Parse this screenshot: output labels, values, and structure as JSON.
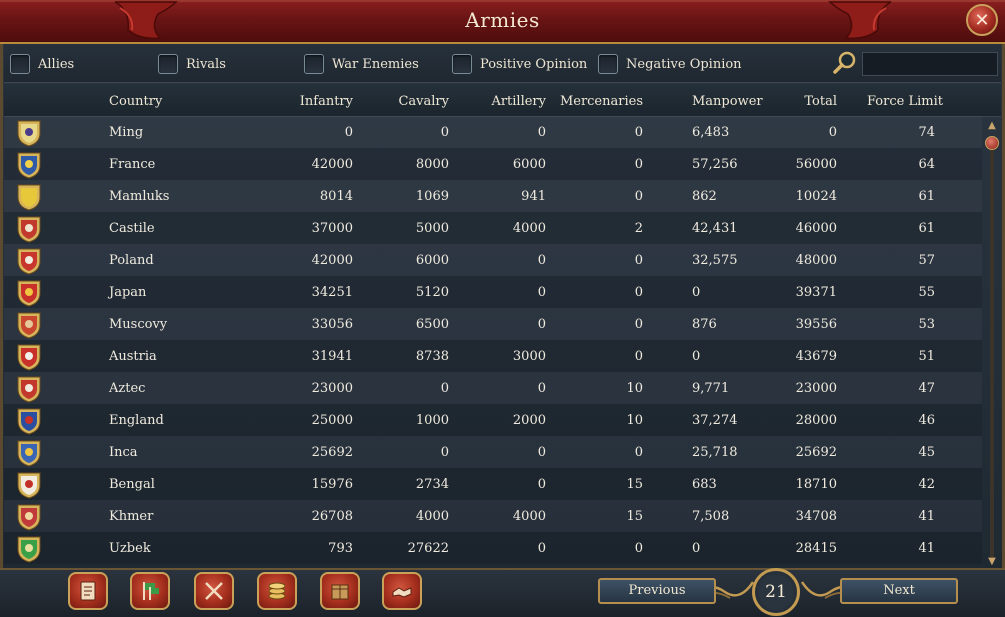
{
  "window": {
    "title": "Armies",
    "close_symbol": "✕"
  },
  "filters": [
    {
      "label": "Allies"
    },
    {
      "label": "Rivals"
    },
    {
      "label": "War Enemies"
    },
    {
      "label": "Positive Opinion"
    },
    {
      "label": "Negative Opinion"
    }
  ],
  "search": {
    "value": "",
    "placeholder": ""
  },
  "table": {
    "headers": [
      "Country",
      "Infantry",
      "Cavalry",
      "Artillery",
      "Mercenaries",
      "Manpower",
      "Total",
      "Force Limit"
    ],
    "rows": [
      {
        "country": "Ming",
        "infantry": "0",
        "cavalry": "0",
        "artillery": "0",
        "mercenaries": "0",
        "manpower": "6,483",
        "total": "0",
        "force_limit": "74",
        "flag": {
          "icon": "ming-flag-icon",
          "bg": "#e8d98a",
          "fg": "#4a3a8a"
        }
      },
      {
        "country": "France",
        "infantry": "42000",
        "cavalry": "8000",
        "artillery": "6000",
        "mercenaries": "0",
        "manpower": "57,256",
        "total": "56000",
        "force_limit": "64",
        "flag": {
          "icon": "france-flag-icon",
          "bg": "#2f5aa8",
          "fg": "#f2d24a"
        }
      },
      {
        "country": "Mamluks",
        "infantry": "8014",
        "cavalry": "1069",
        "artillery": "941",
        "mercenaries": "0",
        "manpower": "862",
        "total": "10024",
        "force_limit": "61",
        "flag": {
          "icon": "mamluks-flag-icon",
          "bg": "#e6c83a",
          "fg": "#e6c83a"
        }
      },
      {
        "country": "Castile",
        "infantry": "37000",
        "cavalry": "5000",
        "artillery": "4000",
        "mercenaries": "2",
        "manpower": "42,431",
        "total": "46000",
        "force_limit": "61",
        "flag": {
          "icon": "castile-flag-icon",
          "bg": "#c23a2e",
          "fg": "#f0e6d0"
        }
      },
      {
        "country": "Poland",
        "infantry": "42000",
        "cavalry": "6000",
        "artillery": "0",
        "mercenaries": "0",
        "manpower": "32,575",
        "total": "48000",
        "force_limit": "57",
        "flag": {
          "icon": "poland-flag-icon",
          "bg": "#c7352c",
          "fg": "#f2ece0"
        }
      },
      {
        "country": "Japan",
        "infantry": "34251",
        "cavalry": "5120",
        "artillery": "0",
        "mercenaries": "0",
        "manpower": "0",
        "total": "39371",
        "force_limit": "55",
        "flag": {
          "icon": "japan-flag-icon",
          "bg": "#c9302a",
          "fg": "#f0c640"
        }
      },
      {
        "country": "Muscovy",
        "infantry": "33056",
        "cavalry": "6500",
        "artillery": "0",
        "mercenaries": "0",
        "manpower": "876",
        "total": "39556",
        "force_limit": "53",
        "flag": {
          "icon": "muscovy-flag-icon",
          "bg": "#c8472e",
          "fg": "#e6c89a"
        }
      },
      {
        "country": "Austria",
        "infantry": "31941",
        "cavalry": "8738",
        "artillery": "3000",
        "mercenaries": "0",
        "manpower": "0",
        "total": "43679",
        "force_limit": "51",
        "flag": {
          "icon": "austria-flag-icon",
          "bg": "#c8302a",
          "fg": "#f3f0ea"
        }
      },
      {
        "country": "Aztec",
        "infantry": "23000",
        "cavalry": "0",
        "artillery": "0",
        "mercenaries": "10",
        "manpower": "9,771",
        "total": "23000",
        "force_limit": "47",
        "flag": {
          "icon": "aztec-flag-icon",
          "bg": "#c2382c",
          "fg": "#f2ece0"
        }
      },
      {
        "country": "England",
        "infantry": "25000",
        "cavalry": "1000",
        "artillery": "2000",
        "mercenaries": "10",
        "manpower": "37,274",
        "total": "28000",
        "force_limit": "46",
        "flag": {
          "icon": "england-flag-icon",
          "bg": "#2a4fa0",
          "fg": "#c8302a"
        }
      },
      {
        "country": "Inca",
        "infantry": "25692",
        "cavalry": "0",
        "artillery": "0",
        "mercenaries": "0",
        "manpower": "25,718",
        "total": "25692",
        "force_limit": "45",
        "flag": {
          "icon": "inca-flag-icon",
          "bg": "#3a64b4",
          "fg": "#f0c640"
        }
      },
      {
        "country": "Bengal",
        "infantry": "15976",
        "cavalry": "2734",
        "artillery": "0",
        "mercenaries": "15",
        "manpower": "683",
        "total": "18710",
        "force_limit": "42",
        "flag": {
          "icon": "bengal-flag-icon",
          "bg": "#f2ece0",
          "fg": "#c2302a"
        }
      },
      {
        "country": "Khmer",
        "infantry": "26708",
        "cavalry": "4000",
        "artillery": "4000",
        "mercenaries": "15",
        "manpower": "7,508",
        "total": "34708",
        "force_limit": "41",
        "flag": {
          "icon": "khmer-flag-icon",
          "bg": "#c03a3a",
          "fg": "#f0d8a0"
        }
      },
      {
        "country": "Uzbek",
        "infantry": "793",
        "cavalry": "27622",
        "artillery": "0",
        "mercenaries": "0",
        "manpower": "0",
        "total": "28415",
        "force_limit": "41",
        "flag": {
          "icon": "uzbek-flag-icon",
          "bg": "#3aa048",
          "fg": "#e8e0a0"
        }
      }
    ]
  },
  "toolbar": [
    {
      "icon": "ledger-icon"
    },
    {
      "icon": "flags-icon"
    },
    {
      "icon": "crossed-swords-icon"
    },
    {
      "icon": "coins-icon"
    },
    {
      "icon": "crate-icon"
    },
    {
      "icon": "handshake-icon"
    }
  ],
  "pagination": {
    "previous_label": "Previous",
    "next_label": "Next",
    "page": "21"
  },
  "colors": {
    "title_red": "#6a1414",
    "gold": "#c39a52",
    "row_text": "#f0ebdf"
  }
}
